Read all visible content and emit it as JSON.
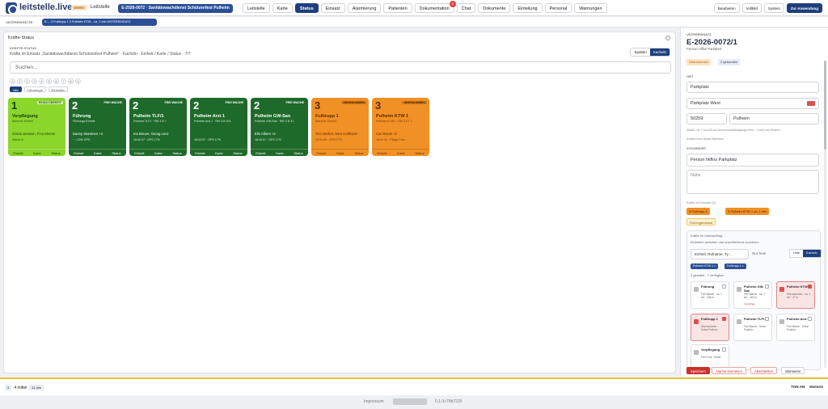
{
  "topbar": {
    "brand": "leitstelle.live",
    "demo": "DEMO",
    "nav_label": "Leitstelle",
    "event": "E-2026-0072 · Sanitätswachdienst Schützenfest Pulheim",
    "tabs": [
      {
        "label": "Leitstelle"
      },
      {
        "label": "Karte"
      },
      {
        "label": "Status"
      },
      {
        "label": "Einsatz"
      },
      {
        "label": "Alarmierung"
      },
      {
        "label": "Patienten"
      },
      {
        "label": "Dokumentation",
        "badge": "4"
      },
      {
        "label": "Chat"
      },
      {
        "label": "Dokumente"
      },
      {
        "label": "Einteilung"
      },
      {
        "label": "Personal"
      },
      {
        "label": "Warnungen"
      }
    ],
    "right_buttons": [
      "Bearbeiten",
      "Vollbild",
      "System",
      "Zur Anwendung"
    ]
  },
  "unitbar": {
    "label": "UNTEREINSÄTZE",
    "chip": "E-... 3 Fußtrupp 1 3 Pulheim KTW... ca. 1 min UNTEREINSATZ"
  },
  "panel": {
    "title": "Kräfte-Status",
    "sub_label": "KRÄFTE-STATUS",
    "sub_text": "Kräfte im Einsatz „Sanitätswachdienst Schützenfest Pulheim\" · Kacheln · Einheit / Karte / Status · 7/7",
    "view_options": [
      "Spalten",
      "Kacheln"
    ],
    "search_placeholder": "Suchen...",
    "status_digits": [
      "0",
      "1",
      "2",
      "3",
      "4",
      "5",
      "6",
      "7",
      "8",
      "9"
    ],
    "filters": [
      "Alle",
      "Fahrzeuge",
      "Einheiten"
    ]
  },
  "units": [
    {
      "status": "1",
      "type": "EINSATZBEREIT",
      "name": "Verpflegung",
      "sub": "Betreuer Einheit",
      "crew": "Gisela Janssen, Finn Klemm",
      "time": "Wacht kl.",
      "color": "lime"
    },
    {
      "status": "2",
      "type": "FREI WACHE",
      "name": "Führung",
      "sub": "Führungs-Einheit",
      "crew": "Danny Stammen +2",
      "time": "··· LOW GPS",
      "color": "green"
    },
    {
      "status": "2",
      "type": "FREI WACHE",
      "name": "Pulheim TLF/1",
      "sub": "Pulheim TLF1 · RW 3 B 7",
      "crew": "Ina Breuer, Georg Lenz",
      "time": "18:42:07 · GPS 17%",
      "color": "green"
    },
    {
      "status": "2",
      "type": "FREI WACHE",
      "name": "Pulheim Arzt 1",
      "sub": "Pulheim Arzt 1 · RW 3 B 201",
      "crew": "",
      "time": "18:42:07 · GPS 17%",
      "color": "green"
    },
    {
      "status": "2",
      "type": "FREI WACHE",
      "name": "Pulheim GW-San",
      "sub": "Pulheim GW-San · RW 3 B 41",
      "crew": "Elin Albers +2",
      "time": "18:42:07 · GPS 17%",
      "color": "green"
    },
    {
      "status": "3",
      "type": "ÜBERNOMMEN",
      "name": "Fußtrupp 1",
      "sub": "Betreuer Einheit",
      "crew": "Tom Becker, Sara Hoffmann",
      "time": "18:41:46 · GPS 17%",
      "color": "orange"
    },
    {
      "status": "3",
      "type": "ÜBERNOMMEN",
      "name": "Pulheim KTW 1",
      "sub": "Pulheim KTW1 · RW 3 KT 1",
      "crew": "Carl Brede +2",
      "time": "18:41:41 · Pflege Frau",
      "color": "orange"
    }
  ],
  "card_actions": [
    "Einheit",
    "Karte",
    "Status"
  ],
  "side": {
    "label": "UNTEREINSATZ",
    "title": "E-2026-0072/1",
    "sub": "Person hilflos Parkplatz",
    "badges": [
      "Übernommen",
      "2 gebunden"
    ],
    "ort_label": "ORT",
    "ort_name": "Parkplatz",
    "ort_street": "Parkplatz West",
    "plz": "50259",
    "city": "Pulheim",
    "ort_hint": "Straße, Nr. 2 und Ort ins Autovervollständigungs-Feld… Karte und Ortstext",
    "ort_check": "Anfahrt auf diese Adresse",
    "stichwort_label": "STICHWORT",
    "stichwort": "Person hilflos Parkplatz",
    "notiz_placeholder": "Notiz",
    "kraefte_label": "Kräfte im Einsatz (2)",
    "assigned": [
      {
        "label": "3 Fußtrupp 1"
      },
      {
        "label": "3 Pulheim KTW 1 ca. 1 min"
      }
    ],
    "alarm_tag": "Rufumgebstand",
    "box_title": "Kräfte im Unterauftrag",
    "box_hint": "Einheiten anheben und anschließend zuordnen.",
    "box_search": "Einheit, Rufname, Ty…",
    "box_check": "Nur freie",
    "box_toggle": [
      "Liste",
      "Kacheln"
    ],
    "box_chips": [
      "Pulheim KTW 1 ×",
      "Fußtrupp 1 ×"
    ],
    "box_count": "2 gewählt · 7 verfügbar",
    "mini": [
      {
        "name": "Führung",
        "sub": "Frei Wache · ca. 1 km · 238 m",
        "tag": "",
        "sel": false
      },
      {
        "name": "Pulheim GW-San",
        "sub": "Frei Wache · ca. 1 km · 163 m",
        "tag": "Vorschlag",
        "sel": false
      },
      {
        "name": "Pulheim KTW 1",
        "sub": "Übernommen · ca. 1 km · 27 m",
        "tag": "",
        "sel": true
      },
      {
        "name": "Fußtrupp 1",
        "sub": "Übernommen · Keine Position",
        "tag": "",
        "sel": true
      },
      {
        "name": "Pulheim TLF/1",
        "sub": "Frei Wache · Keine Position",
        "tag": "",
        "sel": false
      },
      {
        "name": "Pulheim Arzt 1",
        "sub": "Frei Wache · Keine Position",
        "tag": "",
        "sel": false
      },
      {
        "name": "Verpflegung",
        "sub": "Frei Funk · Keine",
        "tag": "",
        "sel": false
      }
    ],
    "buttons": [
      "Speichern",
      "Alarme stornieren",
      "Abschließen",
      "Stornieren"
    ]
  },
  "statusbar": {
    "count": "4",
    "text": "4 mittel",
    "chip": "11 min",
    "right": [
      "TON AN",
      "Historie"
    ]
  },
  "footer": {
    "impressum": "Impressum",
    "version": "0.1.0+78b7225"
  }
}
